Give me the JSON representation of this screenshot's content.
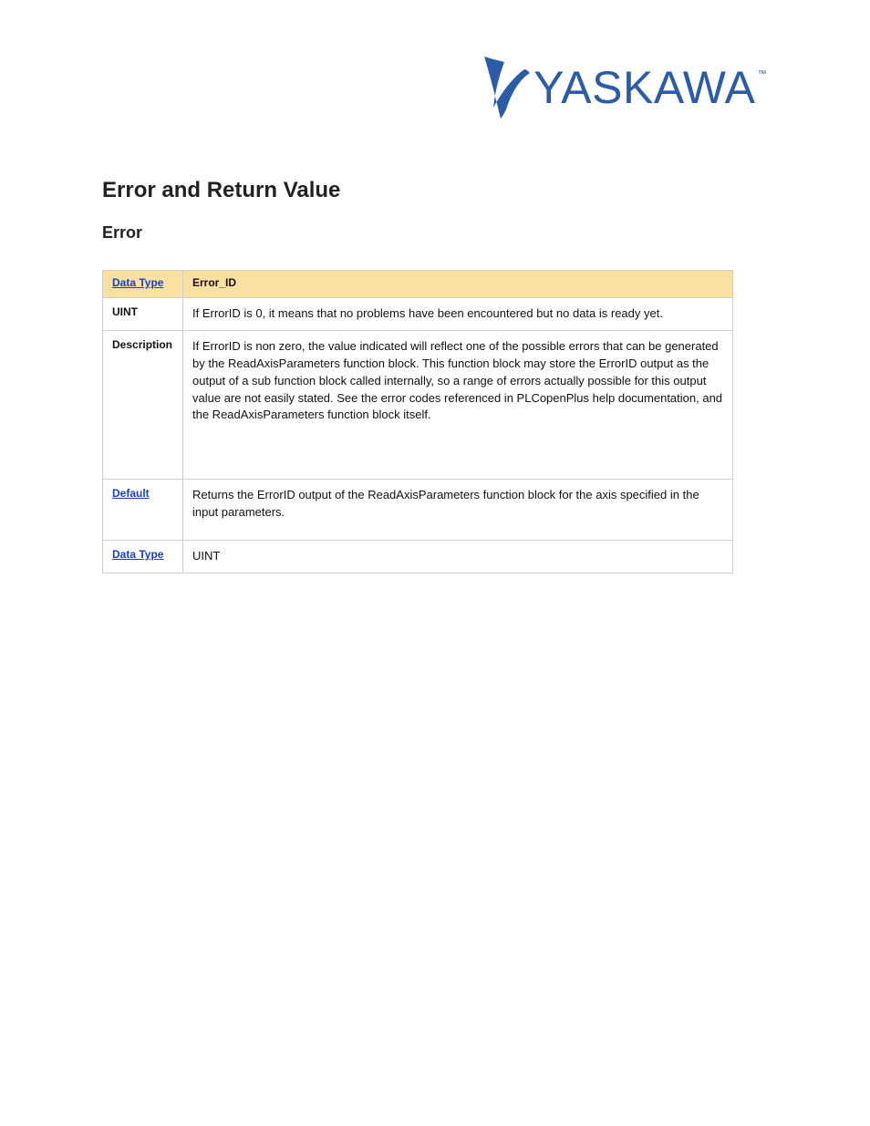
{
  "logo": {
    "brand": "YASKAWA",
    "tm": "™",
    "brand_color": "#2a5ca7"
  },
  "heading1": "Error and Return Value",
  "heading2": "Error",
  "table": {
    "header": {
      "col1": "Data Type",
      "col2": "Error_ID"
    },
    "rows": [
      {
        "col1": "UINT",
        "col2": "If ErrorID is 0, it means that no problems have been encountered but no data is ready yet.",
        "col1_link": false
      },
      {
        "col1": "Description",
        "col2": "If ErrorID is non zero, the value indicated will reflect one of the possible errors that can be generated by the ReadAxisParameters function block. This function block may store the ErrorID output as the output of a sub function block called internally, so a range of errors actually possible for this output value are not easily stated. See the error codes referenced in PLCopenPlus help documentation, and the ReadAxisParameters function block itself.",
        "col1_link": false
      },
      {
        "col1": "Default",
        "col2": "Returns the ErrorID output of the ReadAxisParameters function block for the axis specified in the input parameters.",
        "col1_link": true
      },
      {
        "col1": "Data Type",
        "col2": "UINT",
        "col1_link": true
      }
    ]
  },
  "colors": {
    "header_bg": "#fbe1a1",
    "border": "#cfcfcf",
    "link": "#1a3fbf",
    "brand": "#2a5ca7"
  }
}
